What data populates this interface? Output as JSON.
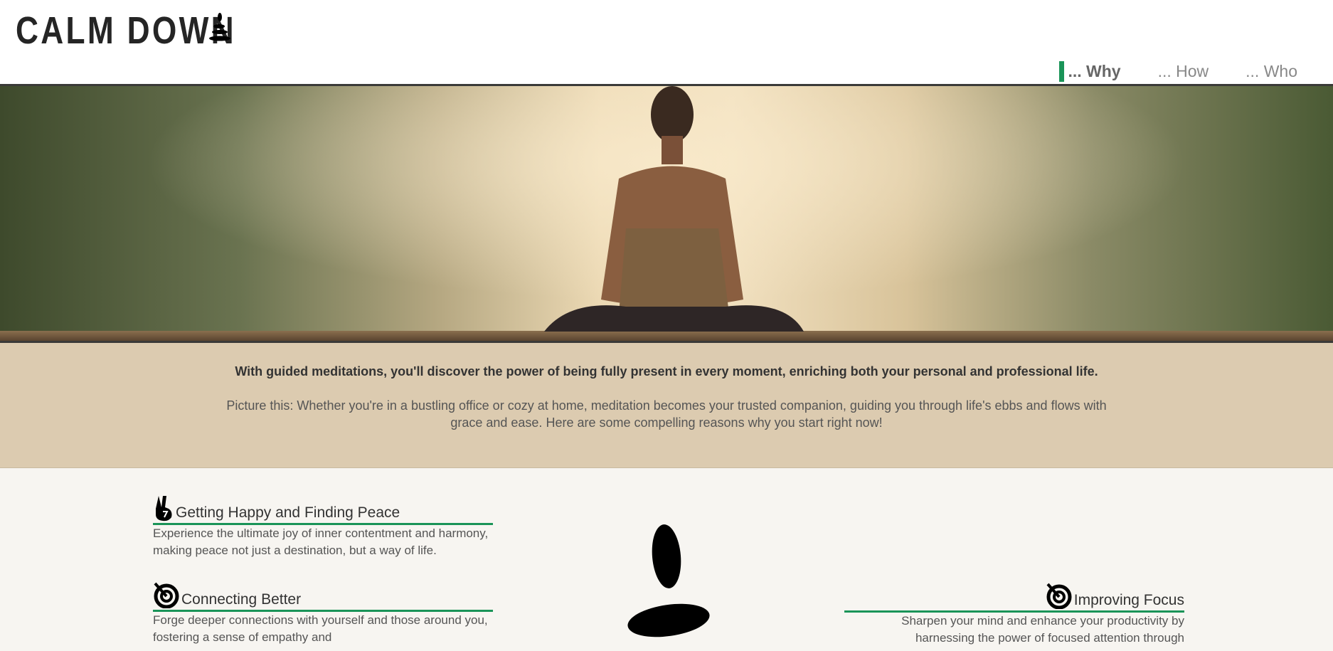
{
  "header": {
    "logo": "CALM DOWN",
    "logo_icon": "stacked-stones-icon"
  },
  "nav": {
    "items": [
      {
        "label": "... Why",
        "active": true
      },
      {
        "label": "... How",
        "active": false
      },
      {
        "label": "... Who",
        "active": false
      }
    ],
    "accent": "#1a9458"
  },
  "intro": {
    "lead": "With guided meditations, you'll discover the power of being fully present in every moment, enriching both your personal and professional life.",
    "sub": "Picture this: Whether you're in a bustling office or cozy at home, meditation becomes your trusted companion, guiding you through life's ebbs and flows with grace and ease. Here are some compelling reasons why you start right now!"
  },
  "features": [
    {
      "icon": "peace-hand-icon",
      "title": "Getting Happy and Finding Peace",
      "text": "Experience the ultimate joy of inner contentment and harmony, making peace not just a destination, but a way of life."
    },
    {
      "icon": "target-icon",
      "title": "Connecting Better",
      "text": "Forge deeper connections with yourself and those around you, fostering a sense of empathy and"
    },
    {
      "icon": "target-icon",
      "title": "Improving Focus",
      "text": "Sharpen your mind and enhance your productivity by harnessing the power of focused attention through"
    }
  ],
  "colors": {
    "intro_bg": "#dccbb0",
    "page_bg": "#f7f5f1",
    "accent": "#1a9458"
  }
}
